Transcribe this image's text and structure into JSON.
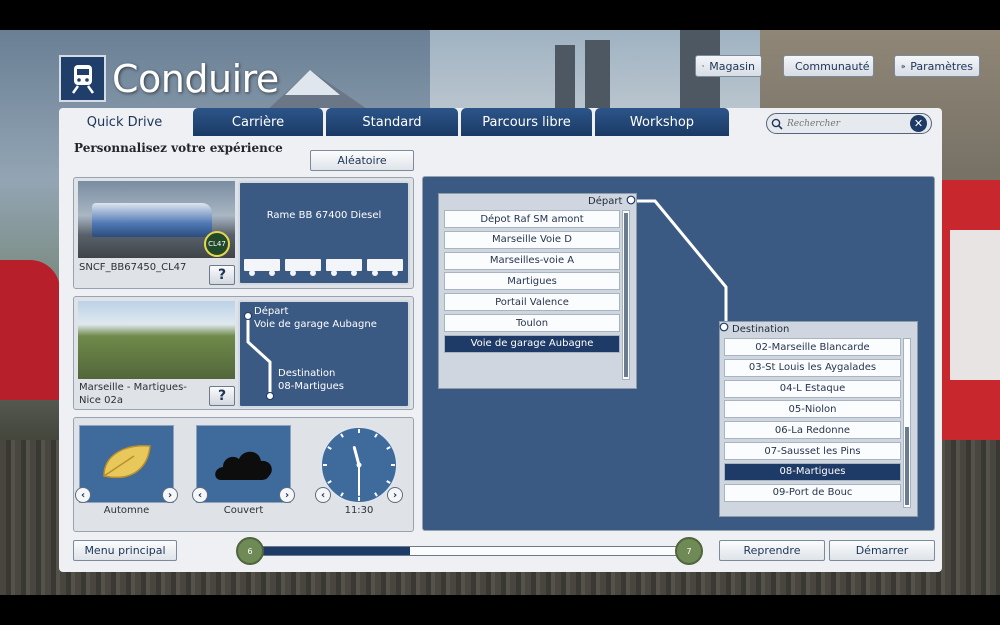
{
  "app": {
    "title": "Conduire"
  },
  "top_buttons": {
    "store": "Magasin",
    "community": "Communauté",
    "settings": "Paramètres"
  },
  "tabs": [
    {
      "label": "Quick Drive",
      "active": true
    },
    {
      "label": "Carrière"
    },
    {
      "label": "Standard"
    },
    {
      "label": "Parcours libre"
    },
    {
      "label": "Workshop"
    }
  ],
  "search": {
    "placeholder": "Rechercher"
  },
  "subtitle": "Personnalisez votre expérience",
  "random_button": "Aléatoire",
  "loco": {
    "name": "SNCF_BB67450_CL47",
    "badge": "CL47",
    "consist": "Rame BB 67400 Diesel",
    "help": "?"
  },
  "route": {
    "name": "Marseille - Martigues-Nice 02a",
    "help": "?",
    "start_label": "Départ",
    "start_value": "Voie de garage Aubagne",
    "dest_label": "Destination",
    "dest_value": "08-Martigues"
  },
  "conditions": {
    "season": "Automne",
    "weather": "Couvert",
    "time": "11:30",
    "clock_hour": 11,
    "clock_minute": 30
  },
  "depart_list": {
    "title": "Départ",
    "items": [
      "Dépot Raf SM amont",
      "Marseille Voie D",
      "Marseilles-voie A",
      "Martigues",
      "Portail Valence",
      "Toulon",
      "Voie de garage Aubagne"
    ],
    "selected_index": 6
  },
  "dest_list": {
    "title": "Destination",
    "items": [
      "02-Marseille Blancarde",
      "03-St Louis les Aygalades",
      "04-L Estaque",
      "05-Niolon",
      "06-La Redonne",
      "07-Sausset les Pins",
      "08-Martigues",
      "09-Port de Bouc"
    ],
    "selected_index": 6
  },
  "footer": {
    "main_menu": "Menu principal",
    "resume": "Reprendre",
    "start": "Démarrer",
    "step_from": "6",
    "step_to": "7",
    "progress_fraction": 0.37
  },
  "colors": {
    "navy": "#1e3a66",
    "panel_blue": "#3b5a83",
    "badge_green": "#6f8a55",
    "leaf_yellow": "#e9c85b"
  }
}
